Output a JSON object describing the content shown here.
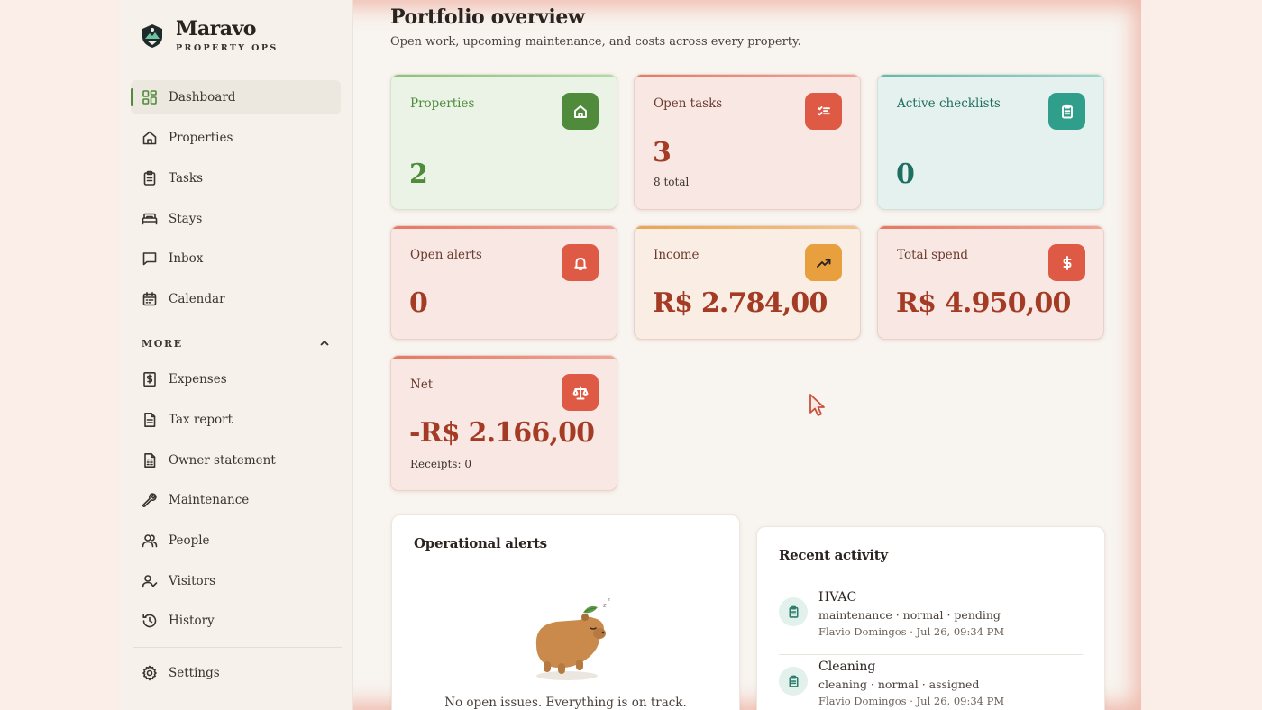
{
  "brand": {
    "name": "Maravo",
    "subtitle": "PROPERTY OPS"
  },
  "sidebar": {
    "primary": [
      {
        "label": "Dashboard",
        "icon": "dashboard-icon",
        "active": true
      },
      {
        "label": "Properties",
        "icon": "home-icon"
      },
      {
        "label": "Tasks",
        "icon": "clipboard-icon"
      },
      {
        "label": "Stays",
        "icon": "bed-icon"
      },
      {
        "label": "Inbox",
        "icon": "message-icon"
      },
      {
        "label": "Calendar",
        "icon": "calendar-icon"
      }
    ],
    "more_label": "MORE",
    "more": [
      {
        "label": "Expenses",
        "icon": "receipt-dollar-icon"
      },
      {
        "label": "Tax report",
        "icon": "document-icon"
      },
      {
        "label": "Owner statement",
        "icon": "statement-icon"
      },
      {
        "label": "Maintenance",
        "icon": "wrench-icon"
      },
      {
        "label": "People",
        "icon": "people-icon"
      },
      {
        "label": "Visitors",
        "icon": "user-check-icon"
      },
      {
        "label": "History",
        "icon": "history-icon"
      }
    ],
    "settings_label": "Settings"
  },
  "page": {
    "title": "Portfolio overview",
    "subtitle": "Open work, upcoming maintenance, and costs across every property."
  },
  "stats": {
    "properties": {
      "label": "Properties",
      "value": "2"
    },
    "open_tasks": {
      "label": "Open tasks",
      "value": "3",
      "note": "8 total"
    },
    "active_checklists": {
      "label": "Active checklists",
      "value": "0"
    },
    "open_alerts": {
      "label": "Open alerts",
      "value": "0"
    },
    "income": {
      "label": "Income",
      "value": "R$ 2.784,00"
    },
    "total_spend": {
      "label": "Total spend",
      "value": "R$ 4.950,00"
    },
    "net": {
      "label": "Net",
      "value": "-R$ 2.166,00",
      "note": "Receipts: 0"
    }
  },
  "alerts_panel": {
    "title": "Operational alerts",
    "empty_text": "No open issues. Everything is on track."
  },
  "activity_panel": {
    "title": "Recent activity",
    "items": [
      {
        "title": "HVAC",
        "meta": "maintenance · normal · pending",
        "who": "Flavio Domingos · Jul 26, 09:34 PM"
      },
      {
        "title": "Cleaning",
        "meta": "cleaning · normal · assigned",
        "who": "Flavio Domingos · Jul 26, 09:34 PM"
      }
    ]
  },
  "colors": {
    "accent_green": "#4f8b3b",
    "accent_red": "#df5a44",
    "accent_teal": "#2f9e8b",
    "accent_amber": "#e8a03f",
    "value_red": "#a43b24"
  }
}
